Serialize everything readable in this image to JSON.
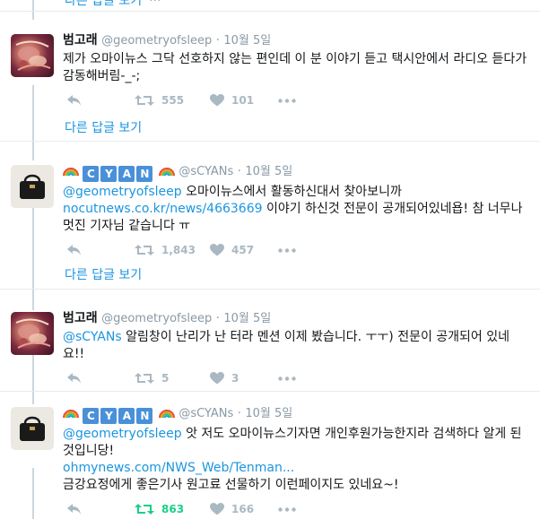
{
  "top_fragment": {
    "text": "다른 답글 보기",
    "more": "···"
  },
  "tweets": [
    {
      "name": "범고래",
      "handle": "@geometryofsleep",
      "dot": "·",
      "time": "10월 5일",
      "text": "제가 오마이뉴스 그닥 선호하지 않는 편인데 이 분 이야기 듣고 택시안에서 라디오 듣다가 감동해버림-_-;",
      "retweets": "555",
      "likes": "101",
      "more_replies": "다른 답글 보기"
    },
    {
      "tiles": [
        "C",
        "Y",
        "A",
        "N"
      ],
      "handle": "@sCYANs",
      "dot": "·",
      "time": "10월 5일",
      "mention": "@geometryofsleep",
      "text_a": " 오마이뉴스에서 활동하신대서 찾아보니까",
      "link": "nocutnews.co.kr/news/4663669",
      "text_b": " 이야기 하신것 전문이 공개되어있네욥! 참 너무나 멋진 기자님 같습니다 ㅠ",
      "retweets": "1,843",
      "likes": "457",
      "more_replies": "다른 답글 보기"
    },
    {
      "name": "범고래",
      "handle": "@geometryofsleep",
      "dot": "·",
      "time": "10월 5일",
      "mention": "@sCYANs",
      "text": " 알림창이 난리가 난 터라 멘션 이제 봤습니다. ㅜㅜ) 전문이 공개되어 있네요!!",
      "retweets": "5",
      "likes": "3"
    },
    {
      "tiles": [
        "C",
        "Y",
        "A",
        "N"
      ],
      "handle": "@sCYANs",
      "dot": "·",
      "time": "10월 5일",
      "mention": "@geometryofsleep",
      "text_a": " 앗 저도 오마이뉴스기자면 개인후원가능한지라 검색하다 알게 된것입니당!",
      "link": "ohmynews.com/NWS_Web/Tenman...",
      "text_b": "금강요정에게 좋은기사 원고료 선물하기 이런페이지도 있네요~!",
      "retweets": "863",
      "likes": "166"
    }
  ],
  "icons": {
    "reply": "reply-icon",
    "retweet": "retweet-icon",
    "like": "heart-icon",
    "more": "more-icon"
  },
  "colors": {
    "link": "#1b95e0",
    "muted": "#8899a6",
    "icon": "#aab8c2",
    "retweet_active": "#19cf86",
    "thread_line": "#ccd6dd",
    "divider": "#e6ecf0"
  }
}
